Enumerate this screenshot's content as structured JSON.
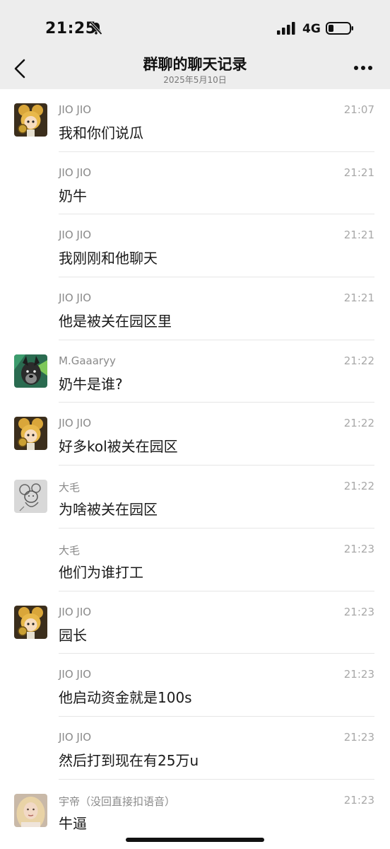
{
  "status_bar": {
    "time": "21:25",
    "network": "4G"
  },
  "header": {
    "title": "群聊的聊天记录",
    "subtitle": "2025年5月10日"
  },
  "messages": [
    {
      "name": "JIO JIO",
      "time": "21:07",
      "text": "我和你们说瓜",
      "avatar": "jiojio"
    },
    {
      "name": "JIO JIO",
      "time": "21:21",
      "text": "奶牛",
      "avatar": ""
    },
    {
      "name": "JIO JIO",
      "time": "21:21",
      "text": "我刚刚和他聊天",
      "avatar": ""
    },
    {
      "name": "JIO JIO",
      "time": "21:21",
      "text": "他是被关在园区里",
      "avatar": ""
    },
    {
      "name": "M.Gaaaryy",
      "time": "21:22",
      "text": "奶牛是谁?",
      "avatar": "dog"
    },
    {
      "name": "JIO JIO",
      "time": "21:22",
      "text": "好多kol被关在园区",
      "avatar": "jiojio"
    },
    {
      "name": "大毛",
      "time": "21:22",
      "text": "为啥被关在园区",
      "avatar": "sketch"
    },
    {
      "name": "大毛",
      "time": "21:23",
      "text": "他们为谁打工",
      "avatar": ""
    },
    {
      "name": "JIO JIO",
      "time": "21:23",
      "text": "园长",
      "avatar": "jiojio"
    },
    {
      "name": "JIO JIO",
      "time": "21:23",
      "text": "他启动资金就是100s",
      "avatar": ""
    },
    {
      "name": "JIO JIO",
      "time": "21:23",
      "text": "然后打到现在有25万u",
      "avatar": ""
    },
    {
      "name": "宇帝（没回直接扣语音）",
      "time": "21:23",
      "text": "牛逼",
      "avatar": "girl"
    }
  ]
}
